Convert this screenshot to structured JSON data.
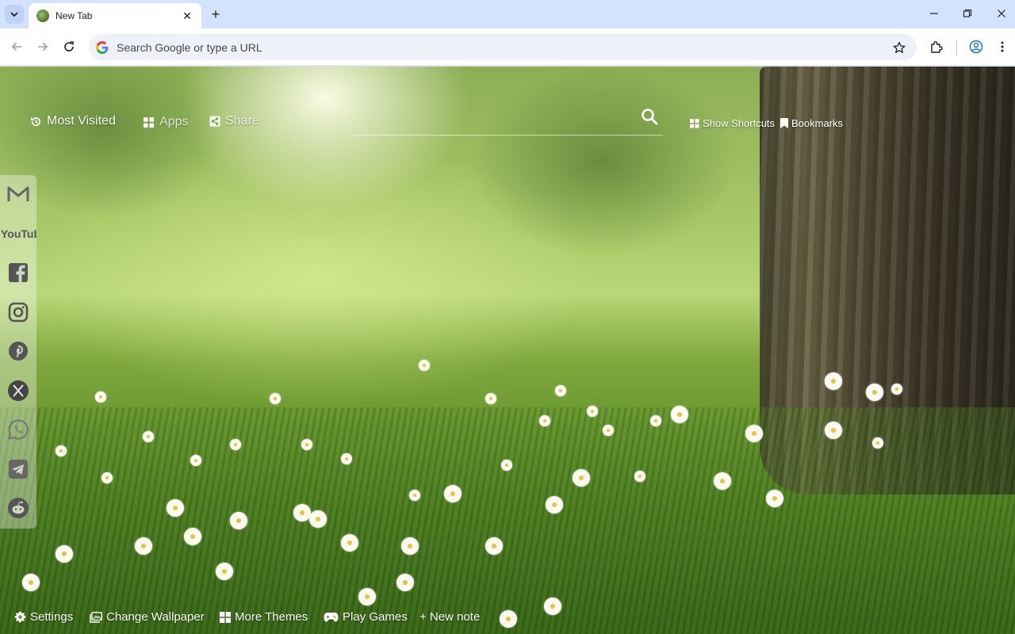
{
  "browser": {
    "tab": {
      "title": "New Tab",
      "close_glyph": "✕"
    },
    "new_tab_glyph": "+",
    "omnibox": {
      "placeholder": "Search Google or type a URL"
    },
    "icons": [
      "tab-search-icon",
      "back-icon",
      "forward-icon",
      "reload-icon",
      "google-g-icon",
      "bookmark-star-icon",
      "extensions-icon",
      "profile-icon",
      "menu-kebab-icon",
      "minimize-icon",
      "restore-icon",
      "close-window-icon"
    ]
  },
  "topnav": {
    "most_visited": "Most Visited",
    "apps": "Apps",
    "share": "Share",
    "show_shortcuts": "Show Shortcuts",
    "bookmarks": "Bookmarks"
  },
  "social": {
    "youtube_text": "YouTube",
    "items": [
      "gmail-icon",
      "youtube-icon",
      "facebook-icon",
      "instagram-icon",
      "pinterest-icon",
      "x-icon",
      "whatsapp-icon",
      "telegram-icon",
      "reddit-icon"
    ]
  },
  "bottombar": {
    "settings": "Settings",
    "change_wallpaper": "Change Wallpaper",
    "more_themes": "More Themes",
    "play_games": "Play Games",
    "new_note": "+ New note"
  },
  "colors": {
    "tabstrip": "#d3e3fd",
    "toolbar": "#ffffff",
    "omnibox": "#eef2f8",
    "overlay_text": "#ffffff"
  }
}
